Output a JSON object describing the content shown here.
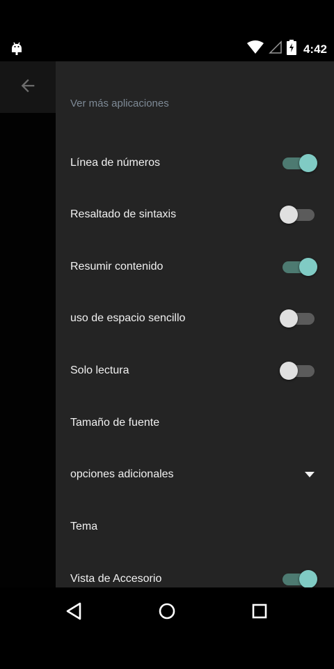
{
  "status_bar": {
    "time": "4:42",
    "notification_icon": "android-debug-icon",
    "icons": [
      "wifi-icon",
      "signal-icon",
      "battery-charging-icon"
    ]
  },
  "toolbar": {
    "back_icon": "arrow-back-icon"
  },
  "drawer": {
    "header": "Ver más aplicaciones",
    "items": [
      {
        "label": "Línea de números",
        "type": "switch",
        "checked": true
      },
      {
        "label": "Resaltado de sintaxis",
        "type": "switch",
        "checked": false
      },
      {
        "label": "Resumir contenido",
        "type": "switch",
        "checked": true
      },
      {
        "label": "uso de espacio sencillo",
        "type": "switch",
        "checked": false
      },
      {
        "label": "Solo lectura",
        "type": "switch",
        "checked": false
      },
      {
        "label": "Tamaño de fuente",
        "type": "text"
      },
      {
        "label": "opciones adicionales",
        "type": "dropdown",
        "icon": "triangle-down-icon"
      },
      {
        "label": "Tema",
        "type": "text"
      },
      {
        "label": "Vista de Accesorio",
        "type": "switch",
        "checked": true
      }
    ]
  },
  "nav_bar": {
    "buttons": [
      "nav-back-icon",
      "nav-home-icon",
      "nav-recents-icon"
    ]
  },
  "colors": {
    "drawer_bg": "#242424",
    "accent": "#80cbc4",
    "header_text": "#7e8a96"
  }
}
